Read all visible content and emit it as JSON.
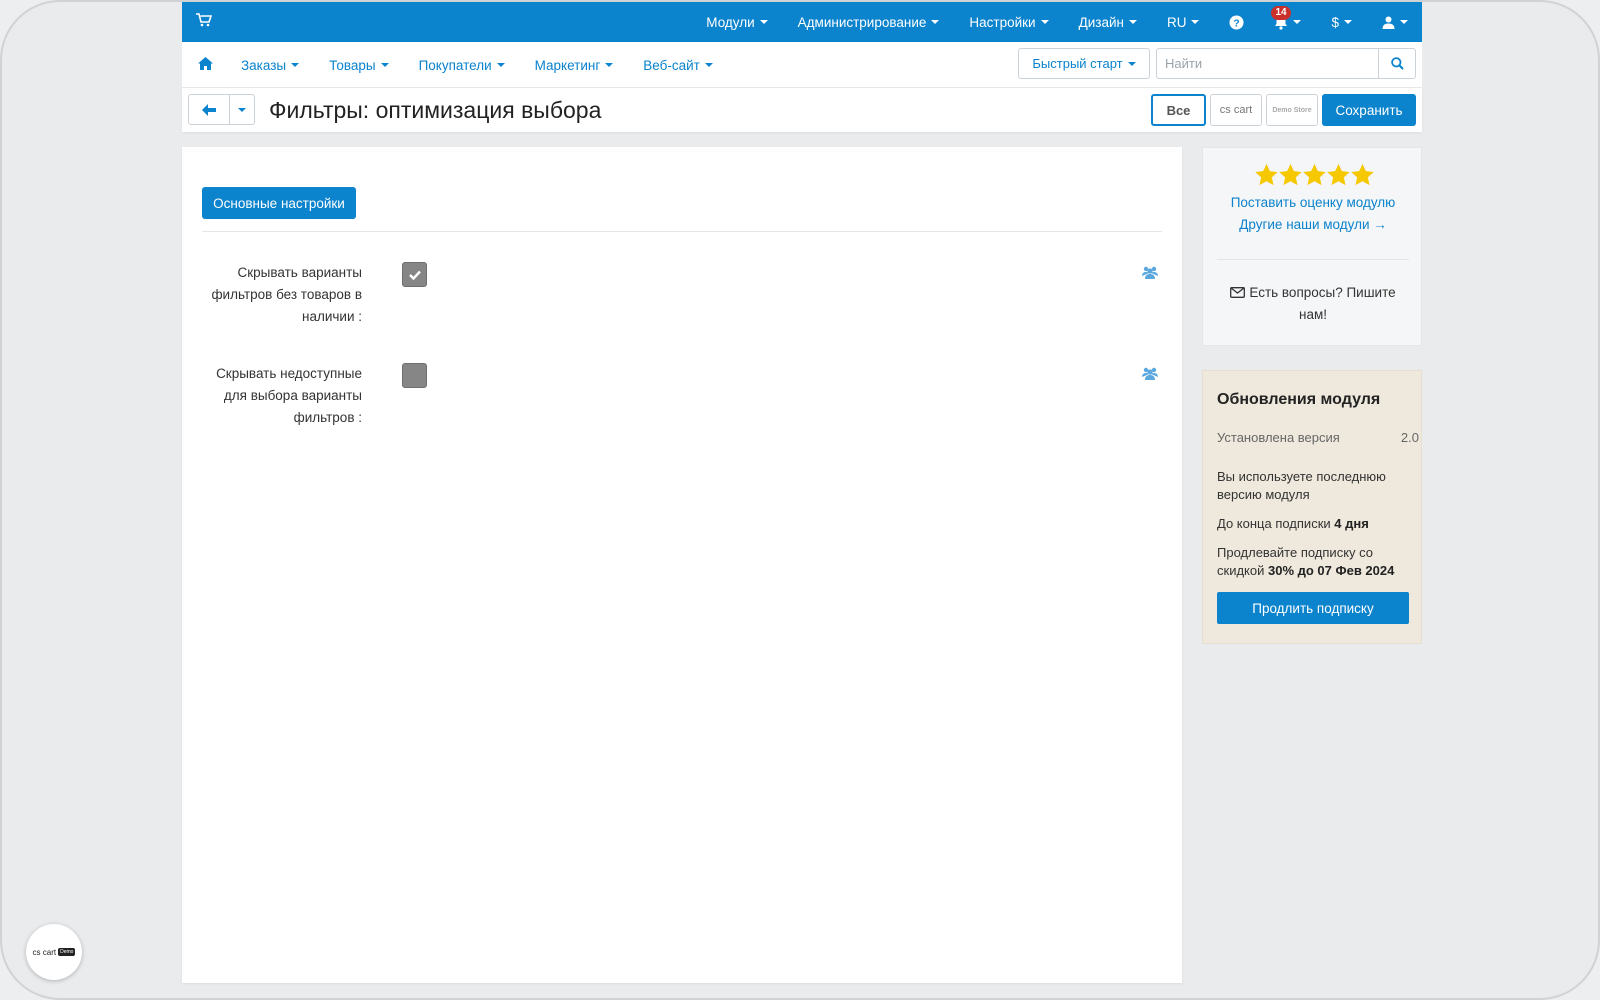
{
  "topbar": {
    "menu": [
      {
        "label": "Модули"
      },
      {
        "label": "Администрирование"
      },
      {
        "label": "Настройки"
      },
      {
        "label": "Дизайн"
      },
      {
        "label": "RU"
      }
    ],
    "notifications_count": "14",
    "currency": "$"
  },
  "navbar": {
    "links": [
      {
        "label": "Заказы"
      },
      {
        "label": "Товары"
      },
      {
        "label": "Покупатели"
      },
      {
        "label": "Маркетинг"
      },
      {
        "label": "Веб-сайт"
      }
    ],
    "quick_start": "Быстрый старт",
    "search_placeholder": "Найти"
  },
  "titlebar": {
    "title": "Фильтры: оптимизация выбора",
    "store_all": "Все",
    "store_cs": "cs cart",
    "store_demo": "Demo Store",
    "save": "Сохранить"
  },
  "main": {
    "tab": "Основные настройки",
    "settings": [
      {
        "label": "Скрывать варианты фильтров без товаров в наличии :",
        "checked": true
      },
      {
        "label": "Скрывать недоступные для выбора варианты фильтров :",
        "checked": false
      }
    ]
  },
  "sidebar": {
    "rate_link": "Поставить оценку модулю",
    "other_link": "Другие наши модули →",
    "questions": "Есть вопросы? Пишите нам!",
    "updates": {
      "title": "Обновления модуля",
      "installed_label": "Установлена версия",
      "installed_value": "2.0",
      "latest_note": "Вы используете последнюю версию модуля",
      "sub_end_prefix": "До конца подписки",
      "sub_end_value": "4 дня",
      "renew_prefix": "Продлевайте подписку со скидкой",
      "renew_value": "30% до 07 Фев 2024",
      "renew_button": "Продлить подписку"
    }
  },
  "float_logo": {
    "text": "cs cart",
    "tag": "Demo"
  },
  "colors": {
    "accent": "#0b83cd",
    "star": "#f5c800",
    "badge": "#c9302c"
  }
}
